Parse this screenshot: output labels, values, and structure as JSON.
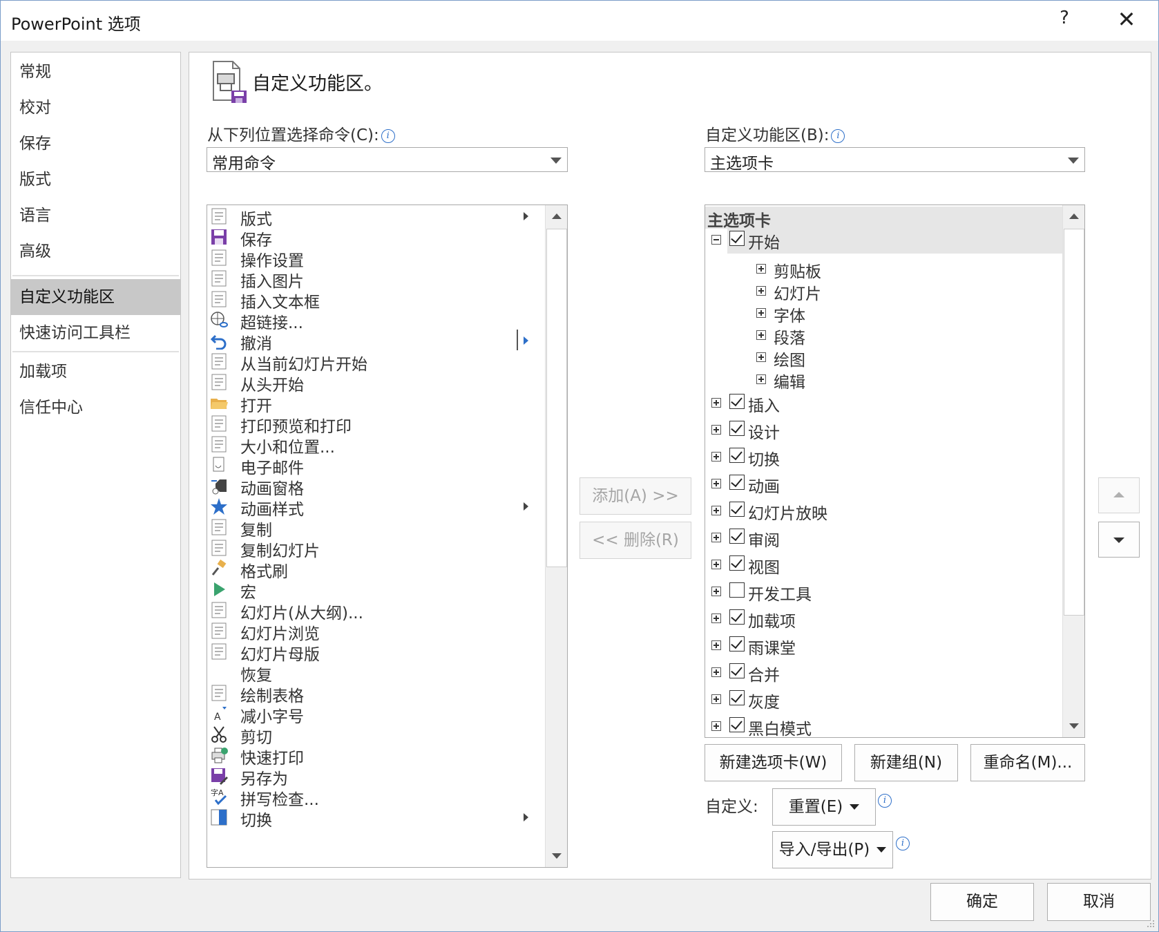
{
  "window": {
    "title": "PowerPoint 选项",
    "help": "?",
    "close": "✕"
  },
  "nav": {
    "items": [
      {
        "label": "常规"
      },
      {
        "label": "校对"
      },
      {
        "label": "保存"
      },
      {
        "label": "版式"
      },
      {
        "label": "语言"
      },
      {
        "label": "高级"
      },
      {
        "label": "自定义功能区",
        "selected": true
      },
      {
        "label": "快速访问工具栏"
      },
      {
        "label": "加载项"
      },
      {
        "label": "信任中心"
      }
    ]
  },
  "main": {
    "heading": "自定义功能区。",
    "choose_label": "从下列位置选择命令(C):",
    "choose_value": "常用命令",
    "customize_label": "自定义功能区(B):",
    "customize_value": "主选项卡",
    "commands": [
      {
        "label": "版式",
        "icon": "layout-icon",
        "sub": true
      },
      {
        "label": "保存",
        "icon": "save-icon"
      },
      {
        "label": "操作设置",
        "icon": "action-settings-icon"
      },
      {
        "label": "插入图片",
        "icon": "insert-picture-icon"
      },
      {
        "label": "插入文本框",
        "icon": "insert-textbox-icon"
      },
      {
        "label": "超链接...",
        "icon": "hyperlink-icon"
      },
      {
        "label": "撤消",
        "icon": "undo-icon",
        "split": true
      },
      {
        "label": "从当前幻灯片开始",
        "icon": "start-from-current-icon"
      },
      {
        "label": "从头开始",
        "icon": "start-from-beginning-icon"
      },
      {
        "label": "打开",
        "icon": "open-folder-icon"
      },
      {
        "label": "打印预览和打印",
        "icon": "print-preview-icon"
      },
      {
        "label": "大小和位置...",
        "icon": "size-position-icon"
      },
      {
        "label": "电子邮件",
        "icon": "email-icon"
      },
      {
        "label": "动画窗格",
        "icon": "animation-pane-icon"
      },
      {
        "label": "动画样式",
        "icon": "animation-styles-icon",
        "sub": true
      },
      {
        "label": "复制",
        "icon": "copy-icon"
      },
      {
        "label": "复制幻灯片",
        "icon": "duplicate-slide-icon"
      },
      {
        "label": "格式刷",
        "icon": "format-painter-icon"
      },
      {
        "label": "宏",
        "icon": "macro-icon"
      },
      {
        "label": "幻灯片(从大纲)...",
        "icon": "slides-from-outline-icon"
      },
      {
        "label": "幻灯片浏览",
        "icon": "slide-sorter-icon"
      },
      {
        "label": "幻灯片母版",
        "icon": "slide-master-icon"
      },
      {
        "label": "恢复",
        "icon": ""
      },
      {
        "label": "绘制表格",
        "icon": "draw-table-icon"
      },
      {
        "label": "减小字号",
        "icon": "decrease-font-icon"
      },
      {
        "label": "剪切",
        "icon": "cut-icon"
      },
      {
        "label": "快速打印",
        "icon": "quick-print-icon"
      },
      {
        "label": "另存为",
        "icon": "save-as-icon"
      },
      {
        "label": "拼写检查...",
        "icon": "spelling-icon"
      },
      {
        "label": "切换",
        "icon": "transitions-icon",
        "sub": true
      }
    ],
    "add_button": "添加(A) >>",
    "remove_button": "<< 删除(R)",
    "tree_header": "主选项卡",
    "tree": [
      {
        "label": "开始",
        "checked": true,
        "expanded": true,
        "groups": [
          "剪贴板",
          "幻灯片",
          "字体",
          "段落",
          "绘图",
          "编辑"
        ]
      },
      {
        "label": "插入",
        "checked": true
      },
      {
        "label": "设计",
        "checked": true
      },
      {
        "label": "切换",
        "checked": true
      },
      {
        "label": "动画",
        "checked": true
      },
      {
        "label": "幻灯片放映",
        "checked": true
      },
      {
        "label": "审阅",
        "checked": true
      },
      {
        "label": "视图",
        "checked": true
      },
      {
        "label": "开发工具",
        "checked": false
      },
      {
        "label": "加载项",
        "checked": true
      },
      {
        "label": "雨课堂",
        "checked": true
      },
      {
        "label": "合并",
        "checked": true
      },
      {
        "label": "灰度",
        "checked": true
      },
      {
        "label": "黑白模式",
        "checked": true
      }
    ],
    "new_tab_button": "新建选项卡(W)",
    "new_group_button": "新建组(N)",
    "rename_button": "重命名(M)...",
    "customize_text": "自定义:",
    "reset_button": "重置(E)",
    "import_export_button": "导入/导出(P)"
  },
  "footer": {
    "ok": "确定",
    "cancel": "取消"
  }
}
